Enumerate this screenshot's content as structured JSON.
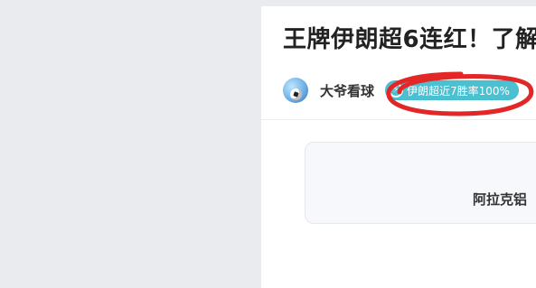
{
  "article": {
    "title": "王牌伊朗超6连红！了解",
    "author": "大爷看球",
    "tag": "伊朗超近7胜率100%",
    "card_text": "阿拉克铝"
  },
  "icons": {
    "tag_icon": "lightning-icon",
    "avatar": "soccer-ball-icon"
  },
  "colors": {
    "tag_bg": "#4ac0d1",
    "annotation_red": "#e32626",
    "page_bg": "#e9ebef"
  }
}
